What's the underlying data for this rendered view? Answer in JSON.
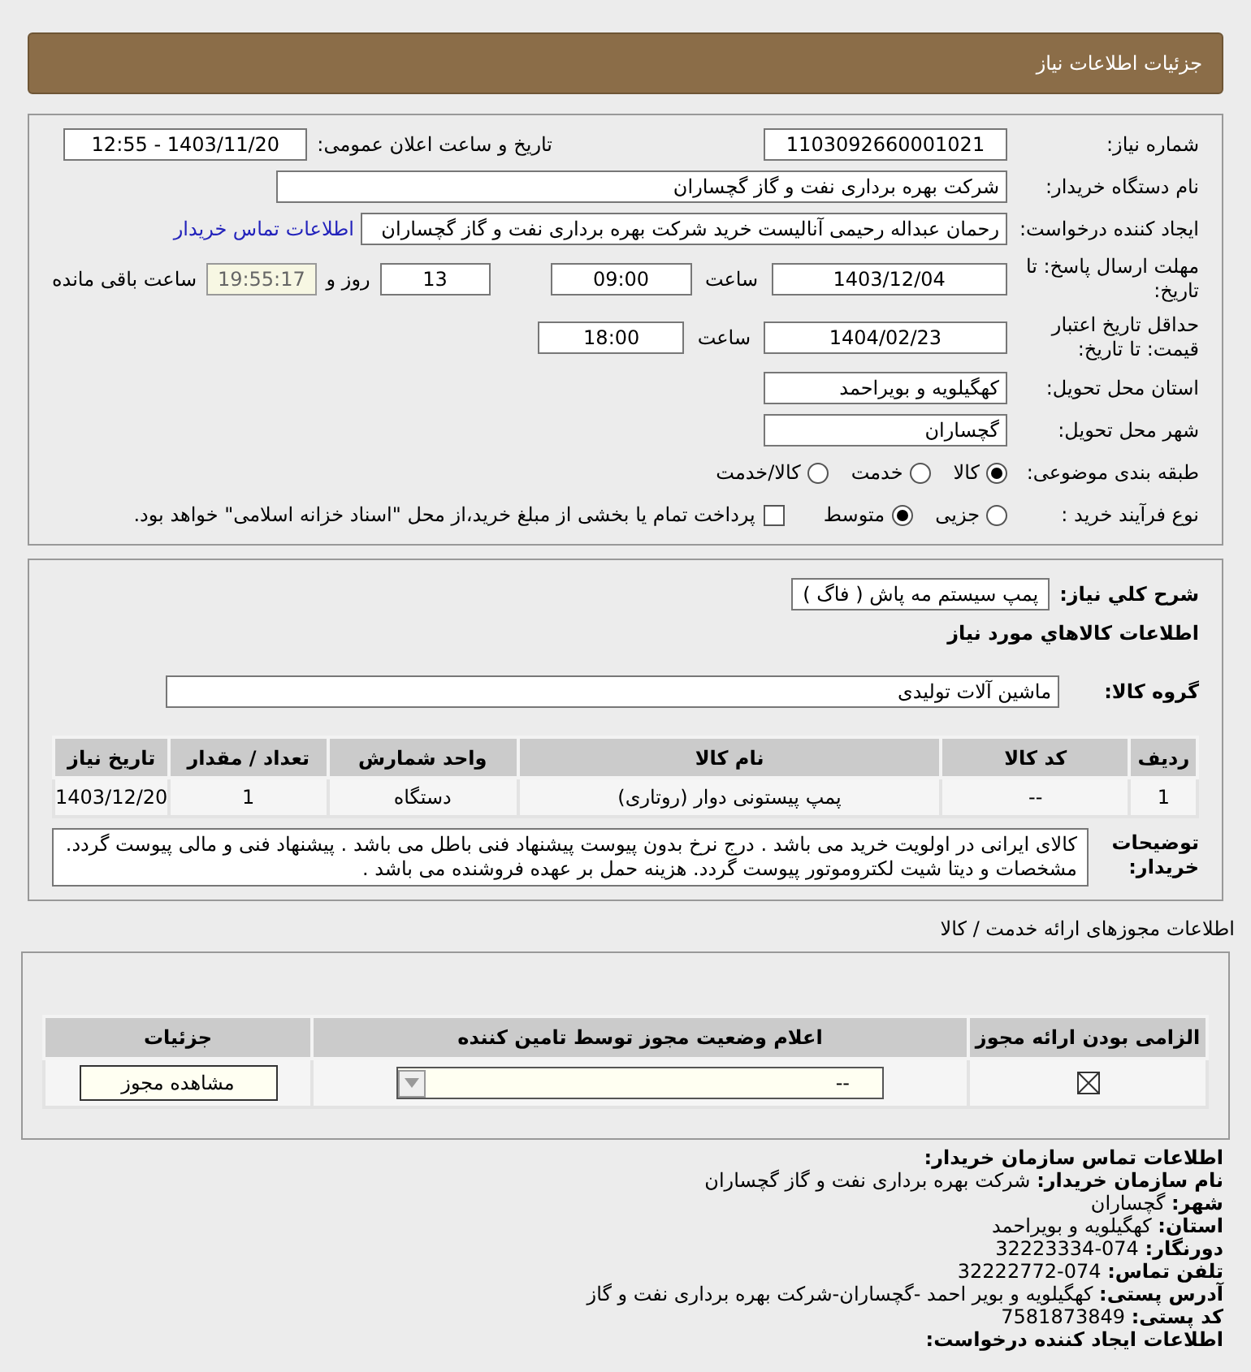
{
  "header": {
    "title": "جزئیات اطلاعات نیاز"
  },
  "need_number": {
    "label": "شماره نیاز:",
    "value": "1103092660001021"
  },
  "announce": {
    "label": "تاریخ و ساعت اعلان عمومی:",
    "value": "1403/11/20 - 12:55"
  },
  "buyer_org": {
    "label": "نام دستگاه خریدار:",
    "value": "شرکت بهره برداری نفت و گاز گچساران"
  },
  "requester": {
    "label": "ایجاد کننده درخواست:",
    "value": "رحمان عبداله رحیمی آنالیست خرید شرکت بهره برداری نفت و گاز گچساران",
    "link": "اطلاعات تماس خریدار"
  },
  "deadline": {
    "label": "مهلت ارسال پاسخ: تا تاریخ:",
    "date": "1403/12/04",
    "time_label": "ساعت",
    "time": "09:00",
    "days": "13",
    "days_label": "روز و",
    "remaining": "19:55:17",
    "remaining_label": "ساعت باقی مانده"
  },
  "validity": {
    "label": "حداقل تاریخ اعتبار قیمت: تا تاریخ:",
    "date": "1404/02/23",
    "time_label": "ساعت",
    "time": "18:00"
  },
  "province": {
    "label": "استان محل تحویل:",
    "value": "کهگیلویه و بویراحمد"
  },
  "city": {
    "label": "شهر محل تحویل:",
    "value": "گچساران"
  },
  "category": {
    "label": "طبقه بندی موضوعی:",
    "options": [
      {
        "label": "کالا",
        "selected": true
      },
      {
        "label": "خدمت",
        "selected": false
      },
      {
        "label": "کالا/خدمت",
        "selected": false
      }
    ]
  },
  "process": {
    "label": "نوع فرآیند خرید :",
    "options": [
      {
        "label": "جزیی",
        "selected": false
      },
      {
        "label": "متوسط",
        "selected": true
      }
    ],
    "payment": {
      "label": "پرداخت تمام یا بخشی از مبلغ خرید،از محل \"اسناد خزانه اسلامی\" خواهد بود.",
      "checked": false
    }
  },
  "summary": {
    "label": "شرح کلي نياز:",
    "value": "پمپ سیستم مه پاش ( فاگ )"
  },
  "goods_title": "اطلاعات کالاهاي مورد نياز",
  "goods_group": {
    "label": "گروه کالا:",
    "value": "ماشین آلات تولیدی"
  },
  "goods_table": {
    "columns": [
      "ردیف",
      "کد کالا",
      "نام کالا",
      "واحد شمارش",
      "تعداد / مقدار",
      "تاریخ نیاز"
    ],
    "rows": [
      [
        "1",
        "--",
        "پمپ پیستونی دوار (روتاری)",
        "دستگاه",
        "1",
        "1403/12/20"
      ]
    ]
  },
  "buyer_notes": {
    "label": "توضیحات خریدار:",
    "value": "کالای ایرانی در اولویت خرید می باشد . درج نرخ بدون پیوست پیشنهاد فنی باطل می باشد . پیشنهاد فنی و مالی پیوست گردد. مشخصات و دیتا شیت لکتروموتور پیوست گردد. هزینه حمل بر عهده فروشنده می باشد ."
  },
  "permits_title": "اطلاعات مجوزهای ارائه خدمت / کالا",
  "permits_table": {
    "columns": [
      "الزامی بودن ارائه مجوز",
      "اعلام وضعیت مجوز توسط تامین کننده",
      "جزئیات"
    ],
    "rows": [
      {
        "required": true,
        "status": "--",
        "action": "مشاهده مجوز"
      }
    ]
  },
  "contact": {
    "title": "اطلاعات تماس سازمان خریدار:",
    "items": [
      {
        "label": "نام سازمان خریدار:",
        "value": "شرکت بهره برداری نفت و گاز گچساران"
      },
      {
        "label": "شهر:",
        "value": "گچساران"
      },
      {
        "label": "استان:",
        "value": "کهگیلویه و بویراحمد"
      },
      {
        "label": "دورنگار:",
        "value": "074-32223334"
      },
      {
        "label": "تلفن تماس:",
        "value": "074-32222772"
      },
      {
        "label": "آدرس پستی:",
        "value": "کهگیلویه و بویر احمد -گچساران-شرکت بهره برداری نفت و گاز"
      },
      {
        "label": "کد پستی:",
        "value": "7581873849"
      }
    ]
  },
  "footer_heading": "اطلاعات ایجاد کننده درخواست:"
}
